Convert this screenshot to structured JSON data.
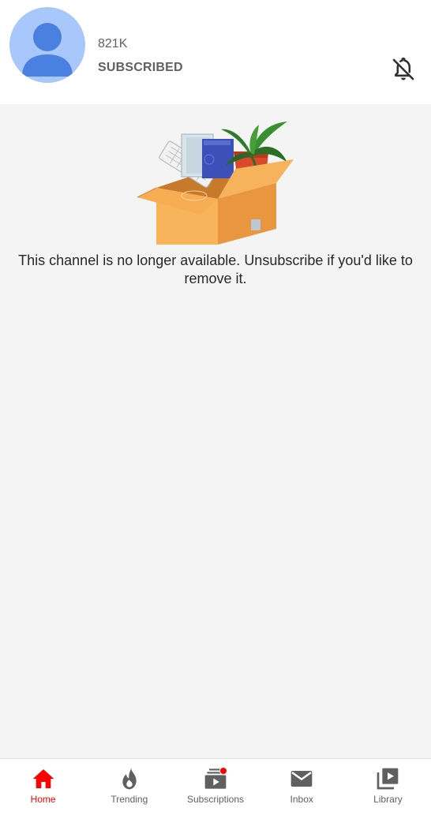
{
  "channel": {
    "subscriber_count": "821K",
    "subscribe_label": "SUBSCRIBED",
    "avatar_icon": "default-person-avatar",
    "notification_icon": "bell-off-icon"
  },
  "content": {
    "illustration": "empty-box-illustration",
    "message": "This channel is no longer available. Unsubscribe if you'd like to remove it."
  },
  "nav": {
    "items": [
      {
        "label": "Home",
        "icon": "home-icon",
        "active": true
      },
      {
        "label": "Trending",
        "icon": "fire-icon",
        "active": false
      },
      {
        "label": "Subscriptions",
        "icon": "subscriptions-icon",
        "active": false,
        "badge": true
      },
      {
        "label": "Inbox",
        "icon": "mail-icon",
        "active": false
      },
      {
        "label": "Library",
        "icon": "library-icon",
        "active": false
      }
    ]
  },
  "colors": {
    "accent": "#ff0000",
    "avatar_bg": "#a8c7fa",
    "avatar_fg": "#4a80e0",
    "text_secondary": "#606060",
    "background": "#f4f4f4"
  }
}
